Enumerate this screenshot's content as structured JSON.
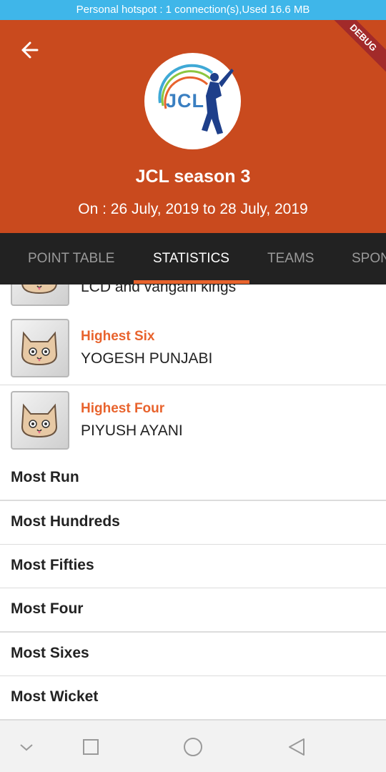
{
  "status_bar": {
    "text": "Personal hotspot : 1 connection(s),Used  16.6 MB"
  },
  "header": {
    "debug_ribbon": "DEBUG",
    "logo_text": "JCL",
    "title": "JCL season 3",
    "date_range": "On : 26 July, 2019 to 28 July, 2019",
    "background_color": "#c94a1e"
  },
  "tabs": [
    {
      "label": "POINT TABLE",
      "active": false
    },
    {
      "label": "STATISTICS",
      "active": true
    },
    {
      "label": "TEAMS",
      "active": false
    },
    {
      "label": "SPONSORS",
      "active": false
    }
  ],
  "stats": [
    {
      "label": "",
      "value": "LCD and vangani kings",
      "icon": "cat-avatar-icon"
    },
    {
      "label": "Highest Six",
      "value": "YOGESH PUNJABI",
      "icon": "cat-avatar-icon"
    },
    {
      "label": "Highest Four",
      "value": "PIYUSH AYANI",
      "icon": "cat-avatar-icon"
    }
  ],
  "categories": [
    {
      "label": "Most Run"
    },
    {
      "label": "Most Hundreds"
    },
    {
      "label": "Most Fifties"
    },
    {
      "label": "Most Four"
    },
    {
      "label": "Most Sixes"
    },
    {
      "label": "Most Wicket"
    }
  ],
  "colors": {
    "accent": "#e8632d",
    "tab_bar": "#222222",
    "status_bar": "#3fb6e9"
  },
  "nav": {
    "icons": [
      "chevron-down-icon",
      "square-icon",
      "circle-icon",
      "back-triangle-icon"
    ]
  }
}
